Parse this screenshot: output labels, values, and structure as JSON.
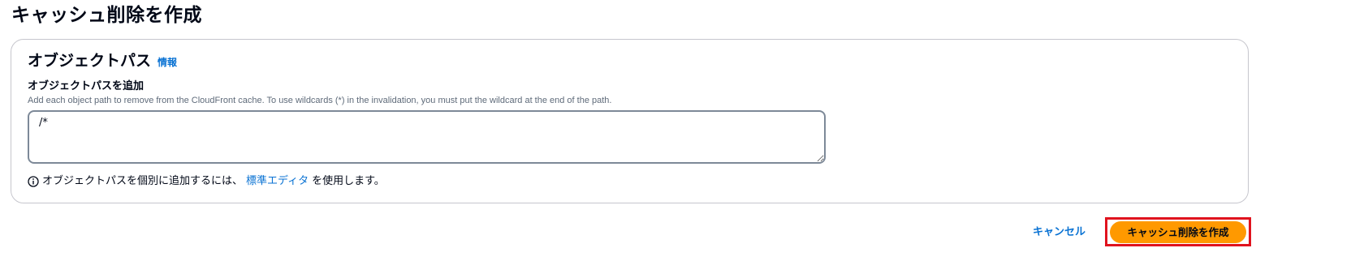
{
  "page": {
    "title": "キャッシュ削除を作成"
  },
  "panel": {
    "title": "オブジェクトパス",
    "info_link": "情報",
    "field_label": "オブジェクトパスを追加",
    "field_description": "Add each object path to remove from the CloudFront cache. To use wildcards (*) in the invalidation, you must put the wildcard at the end of the path.",
    "path_value": "/*",
    "hint": {
      "prefix": "オブジェクトパスを個別に追加するには、",
      "link": "標準エディタ",
      "suffix": "を使用します。",
      "icon": "info-circle-icon"
    }
  },
  "actions": {
    "cancel_label": "キャンセル",
    "primary_label": "キャッシュ削除を作成"
  },
  "colors": {
    "link": "#0972d3",
    "primary_button": "#ff9900",
    "highlight_border": "#e0131e",
    "text": "#000716",
    "muted_text": "#5f6b7a",
    "border": "#c6c6cd"
  }
}
